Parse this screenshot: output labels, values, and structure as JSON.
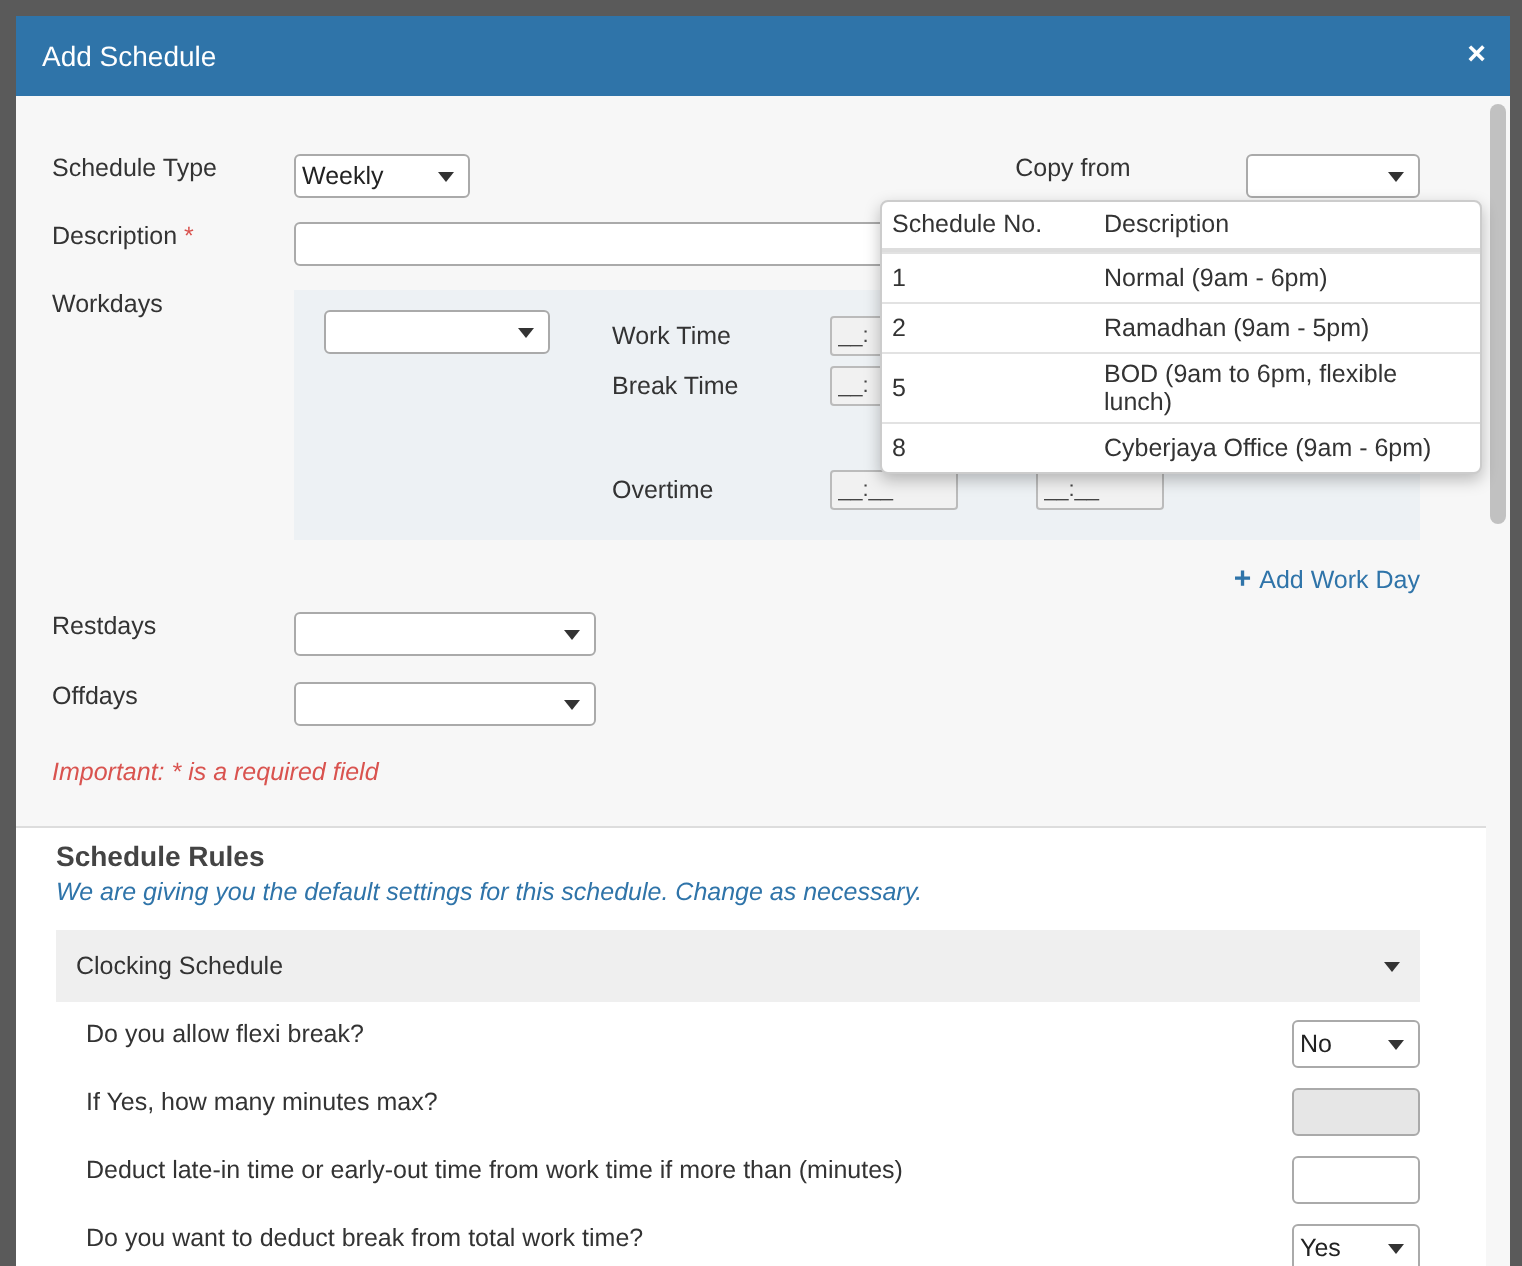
{
  "dialog": {
    "title": "Add Schedule",
    "close": "×"
  },
  "form": {
    "schedule_type": {
      "label": "Schedule Type",
      "value": "Weekly"
    },
    "copy_from": {
      "label": "Copy from"
    },
    "description": {
      "label": "Description",
      "required_mark": "*"
    },
    "workdays": {
      "label": "Workdays",
      "times": [
        {
          "label": "Work Time",
          "fields": [
            "__:"
          ]
        },
        {
          "label": "Break Time",
          "fields": [
            "__:"
          ]
        },
        {
          "label": "Overtime",
          "fields": [
            "__:__",
            "__:__"
          ]
        }
      ]
    },
    "add_work_day": {
      "icon": "+",
      "label": "Add Work Day"
    },
    "restdays": {
      "label": "Restdays"
    },
    "offdays": {
      "label": "Offdays"
    },
    "note": "Important: * is a required field"
  },
  "copy_popup": {
    "columns": [
      "Schedule No.",
      "Description"
    ],
    "rows": [
      {
        "no": "1",
        "description": "Normal (9am - 6pm)"
      },
      {
        "no": "2",
        "description": "Ramadhan (9am - 5pm)"
      },
      {
        "no": "5",
        "description": "BOD (9am to 6pm, flexible lunch)"
      },
      {
        "no": "8",
        "description": "Cyberjaya Office (9am - 6pm)"
      }
    ]
  },
  "rules": {
    "title": "Schedule Rules",
    "subtitle": "We are giving you the default settings for this schedule. Change as necessary.",
    "section": {
      "title": "Clocking Schedule",
      "expanded": true,
      "items": [
        {
          "kind": "select",
          "label": "Do you allow flexi break?",
          "value": "No",
          "disabled": false
        },
        {
          "kind": "input",
          "label": "If Yes, how many minutes max?",
          "value": "",
          "disabled": true
        },
        {
          "kind": "input",
          "label": "Deduct late-in time or early-out time from work time if more than (minutes)",
          "value": "",
          "disabled": false
        },
        {
          "kind": "select",
          "label": "Do you want to deduct break from total work time?",
          "value": "Yes",
          "disabled": false
        }
      ]
    }
  }
}
